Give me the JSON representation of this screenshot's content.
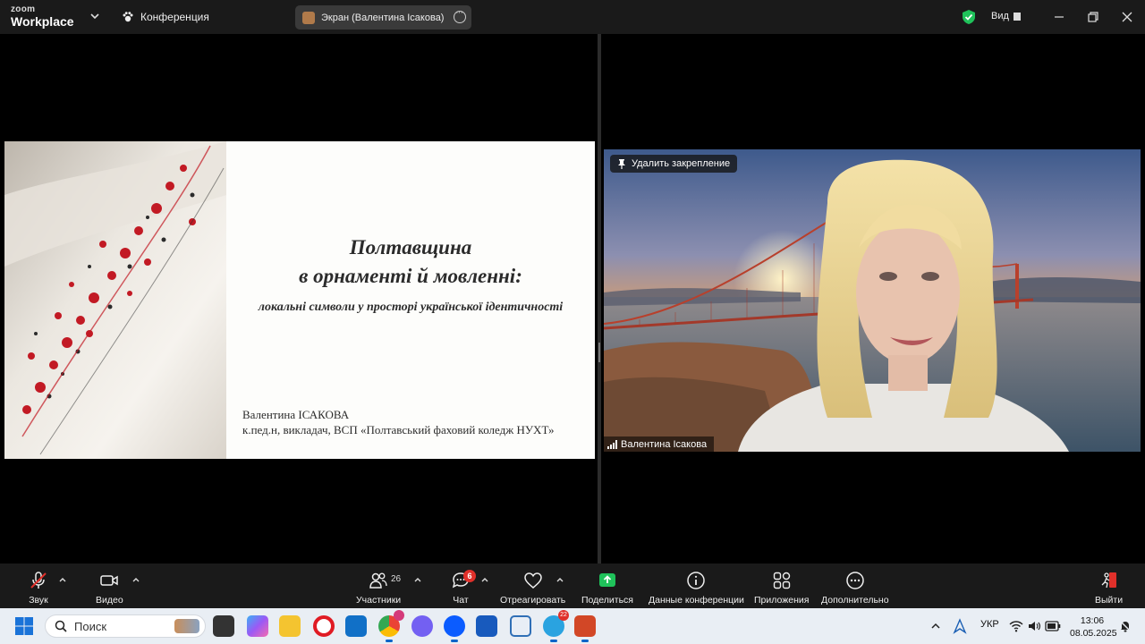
{
  "titlebar": {
    "logo_top": "zoom",
    "logo_bottom": "Workplace",
    "meeting_label": "Конференция",
    "screen_share_label": "Экран (Валентина Ісакова)",
    "view_label": "Вид"
  },
  "slide": {
    "title_line1": "Полтавщина",
    "title_line2": "в орнаменті й мовленні:",
    "subtitle": "локальні символи у просторі української ідентичності",
    "author_name": "Валентина ІСАКОВА",
    "author_details": "к.пед.н, викладач, ВСП «Полтавський фаховий коледж НУХТ»"
  },
  "video": {
    "unpin_label": "Удалить закрепление",
    "participant_name": "Валентина Ісакова"
  },
  "toolbar": {
    "audio_label": "Звук",
    "video_label": "Видео",
    "participants_label": "Участники",
    "participants_count": "26",
    "chat_label": "Чат",
    "chat_badge": "6",
    "react_label": "Отреагировать",
    "share_label": "Поделиться",
    "meeting_info_label": "Данные конференции",
    "apps_label": "Приложения",
    "more_label": "Дополнительно",
    "leave_label": "Выйти"
  },
  "taskbar": {
    "search_placeholder": "Поиск",
    "telegram_badge": "22",
    "language": "УКР",
    "time": "13:06",
    "date": "08.05.2025"
  },
  "colors": {
    "accent_green": "#1fc25a",
    "leave_red": "#e0302a",
    "badge_red": "#e0302a"
  }
}
